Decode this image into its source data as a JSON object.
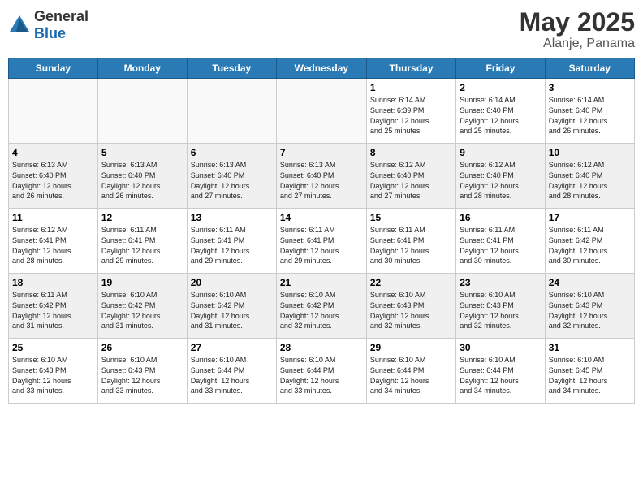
{
  "logo": {
    "general": "General",
    "blue": "Blue"
  },
  "title": {
    "month_year": "May 2025",
    "location": "Alanje, Panama"
  },
  "headers": [
    "Sunday",
    "Monday",
    "Tuesday",
    "Wednesday",
    "Thursday",
    "Friday",
    "Saturday"
  ],
  "weeks": [
    [
      {
        "day": "",
        "info": ""
      },
      {
        "day": "",
        "info": ""
      },
      {
        "day": "",
        "info": ""
      },
      {
        "day": "",
        "info": ""
      },
      {
        "day": "1",
        "info": "Sunrise: 6:14 AM\nSunset: 6:39 PM\nDaylight: 12 hours\nand 25 minutes."
      },
      {
        "day": "2",
        "info": "Sunrise: 6:14 AM\nSunset: 6:40 PM\nDaylight: 12 hours\nand 25 minutes."
      },
      {
        "day": "3",
        "info": "Sunrise: 6:14 AM\nSunset: 6:40 PM\nDaylight: 12 hours\nand 26 minutes."
      }
    ],
    [
      {
        "day": "4",
        "info": "Sunrise: 6:13 AM\nSunset: 6:40 PM\nDaylight: 12 hours\nand 26 minutes."
      },
      {
        "day": "5",
        "info": "Sunrise: 6:13 AM\nSunset: 6:40 PM\nDaylight: 12 hours\nand 26 minutes."
      },
      {
        "day": "6",
        "info": "Sunrise: 6:13 AM\nSunset: 6:40 PM\nDaylight: 12 hours\nand 27 minutes."
      },
      {
        "day": "7",
        "info": "Sunrise: 6:13 AM\nSunset: 6:40 PM\nDaylight: 12 hours\nand 27 minutes."
      },
      {
        "day": "8",
        "info": "Sunrise: 6:12 AM\nSunset: 6:40 PM\nDaylight: 12 hours\nand 27 minutes."
      },
      {
        "day": "9",
        "info": "Sunrise: 6:12 AM\nSunset: 6:40 PM\nDaylight: 12 hours\nand 28 minutes."
      },
      {
        "day": "10",
        "info": "Sunrise: 6:12 AM\nSunset: 6:40 PM\nDaylight: 12 hours\nand 28 minutes."
      }
    ],
    [
      {
        "day": "11",
        "info": "Sunrise: 6:12 AM\nSunset: 6:41 PM\nDaylight: 12 hours\nand 28 minutes."
      },
      {
        "day": "12",
        "info": "Sunrise: 6:11 AM\nSunset: 6:41 PM\nDaylight: 12 hours\nand 29 minutes."
      },
      {
        "day": "13",
        "info": "Sunrise: 6:11 AM\nSunset: 6:41 PM\nDaylight: 12 hours\nand 29 minutes."
      },
      {
        "day": "14",
        "info": "Sunrise: 6:11 AM\nSunset: 6:41 PM\nDaylight: 12 hours\nand 29 minutes."
      },
      {
        "day": "15",
        "info": "Sunrise: 6:11 AM\nSunset: 6:41 PM\nDaylight: 12 hours\nand 30 minutes."
      },
      {
        "day": "16",
        "info": "Sunrise: 6:11 AM\nSunset: 6:41 PM\nDaylight: 12 hours\nand 30 minutes."
      },
      {
        "day": "17",
        "info": "Sunrise: 6:11 AM\nSunset: 6:42 PM\nDaylight: 12 hours\nand 30 minutes."
      }
    ],
    [
      {
        "day": "18",
        "info": "Sunrise: 6:11 AM\nSunset: 6:42 PM\nDaylight: 12 hours\nand 31 minutes."
      },
      {
        "day": "19",
        "info": "Sunrise: 6:10 AM\nSunset: 6:42 PM\nDaylight: 12 hours\nand 31 minutes."
      },
      {
        "day": "20",
        "info": "Sunrise: 6:10 AM\nSunset: 6:42 PM\nDaylight: 12 hours\nand 31 minutes."
      },
      {
        "day": "21",
        "info": "Sunrise: 6:10 AM\nSunset: 6:42 PM\nDaylight: 12 hours\nand 32 minutes."
      },
      {
        "day": "22",
        "info": "Sunrise: 6:10 AM\nSunset: 6:43 PM\nDaylight: 12 hours\nand 32 minutes."
      },
      {
        "day": "23",
        "info": "Sunrise: 6:10 AM\nSunset: 6:43 PM\nDaylight: 12 hours\nand 32 minutes."
      },
      {
        "day": "24",
        "info": "Sunrise: 6:10 AM\nSunset: 6:43 PM\nDaylight: 12 hours\nand 32 minutes."
      }
    ],
    [
      {
        "day": "25",
        "info": "Sunrise: 6:10 AM\nSunset: 6:43 PM\nDaylight: 12 hours\nand 33 minutes."
      },
      {
        "day": "26",
        "info": "Sunrise: 6:10 AM\nSunset: 6:43 PM\nDaylight: 12 hours\nand 33 minutes."
      },
      {
        "day": "27",
        "info": "Sunrise: 6:10 AM\nSunset: 6:44 PM\nDaylight: 12 hours\nand 33 minutes."
      },
      {
        "day": "28",
        "info": "Sunrise: 6:10 AM\nSunset: 6:44 PM\nDaylight: 12 hours\nand 33 minutes."
      },
      {
        "day": "29",
        "info": "Sunrise: 6:10 AM\nSunset: 6:44 PM\nDaylight: 12 hours\nand 34 minutes."
      },
      {
        "day": "30",
        "info": "Sunrise: 6:10 AM\nSunset: 6:44 PM\nDaylight: 12 hours\nand 34 minutes."
      },
      {
        "day": "31",
        "info": "Sunrise: 6:10 AM\nSunset: 6:45 PM\nDaylight: 12 hours\nand 34 minutes."
      }
    ]
  ]
}
